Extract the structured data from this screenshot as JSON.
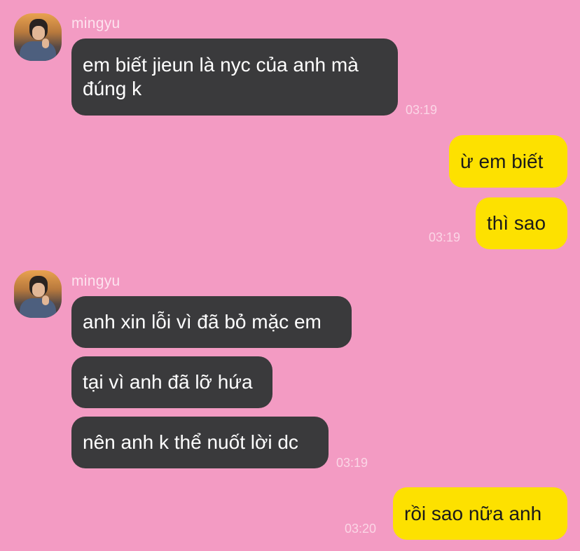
{
  "chat": {
    "contact_name": "mingyu",
    "groups": [
      {
        "side": "left",
        "sender": "mingyu",
        "messages": [
          "em biết jieun là nyc của anh mà đúng k"
        ],
        "time": "03:19"
      },
      {
        "side": "right",
        "messages": [
          "ừ em biết",
          "thì sao"
        ],
        "time": "03:19"
      },
      {
        "side": "left",
        "sender": "mingyu",
        "messages": [
          "anh xin lỗi vì đã bỏ mặc em",
          "tại vì anh đã lỡ hứa",
          "nên anh k thể nuốt lời dc"
        ],
        "time": "03:19"
      },
      {
        "side": "right",
        "messages": [
          "rồi sao nữa anh"
        ],
        "time": "03:20"
      }
    ]
  },
  "colors": {
    "background": "#f39bc3",
    "incoming_bubble": "#3a3a3c",
    "outgoing_bubble": "#fde100"
  },
  "icons": {
    "avatar": "profile-photo"
  }
}
